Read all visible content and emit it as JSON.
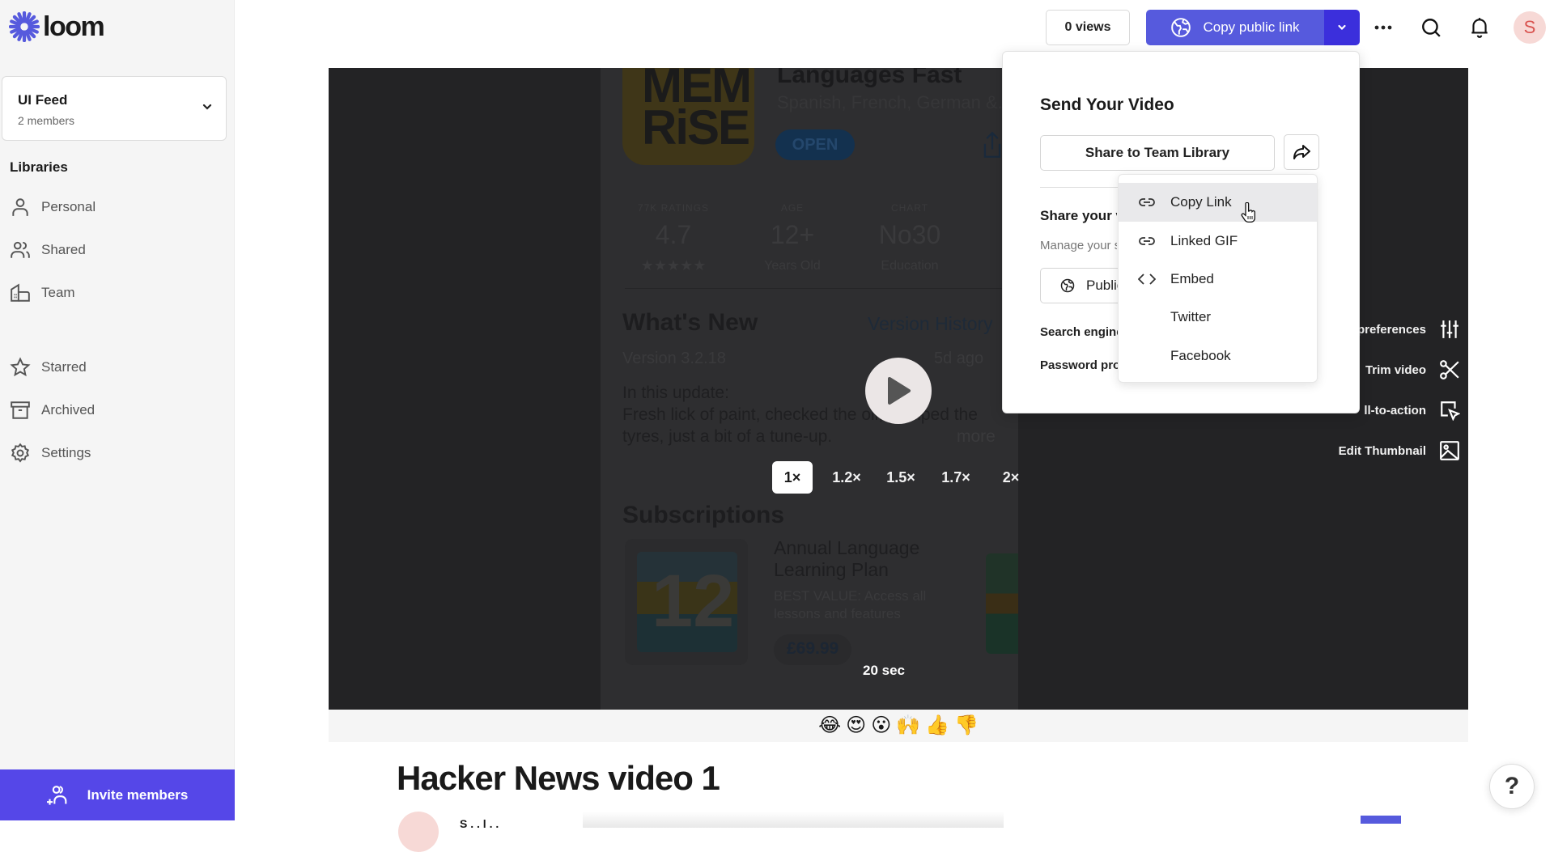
{
  "app": {
    "brand": "loom",
    "brand_color": "#565ADD"
  },
  "sidebar": {
    "workspace": {
      "name": "UI Feed",
      "members": "2 members"
    },
    "libraries_title": "Libraries",
    "items": [
      {
        "label": "Personal",
        "icon": "person-icon"
      },
      {
        "label": "Shared",
        "icon": "people-icon"
      },
      {
        "label": "Team",
        "icon": "building-icon"
      },
      {
        "label": "Starred",
        "icon": "star-icon"
      },
      {
        "label": "Archived",
        "icon": "archive-icon"
      },
      {
        "label": "Settings",
        "icon": "gear-icon"
      }
    ],
    "invite_label": "Invite members"
  },
  "topbar": {
    "views": "0 views",
    "copy_link_label": "Copy public link",
    "avatar_initial": "S"
  },
  "video": {
    "screen": {
      "app_icon_text": "MEM\nRiSE",
      "app_title": "Languages Fast",
      "app_subtitle": "Spanish, French, German &...",
      "open_label": "OPEN",
      "stats": [
        {
          "label": "77K RATINGS",
          "value": "4.7",
          "sub": "★★★★★"
        },
        {
          "label": "AGE",
          "value": "12+",
          "sub": "Years Old"
        },
        {
          "label": "CHART",
          "value": "No30",
          "sub": "Education"
        }
      ],
      "whats_new": "What's New",
      "version_history": "Version History",
      "version": "Version 3.2.18",
      "version_age": "5d ago",
      "update_line1": "In this update:",
      "update_line2": "Fresh lick of paint, checked the oil, pumped the",
      "update_line3": "tyres, just a bit of a tune-up.",
      "more": "more",
      "subscriptions": "Subscriptions",
      "plan_title1": "Annual Language",
      "plan_title2": "Learning Plan",
      "plan_desc1": "BEST VALUE: Access all",
      "plan_desc2": "lessons and features",
      "plan_price": "£69.99",
      "plan_icon_text": "12"
    },
    "speeds": [
      "1×",
      "1.2×",
      "1.5×",
      "1.7×",
      "2×"
    ],
    "active_speed": "1×",
    "duration": "20 sec",
    "tools": [
      {
        "label": "preferences",
        "icon": "sliders-icon"
      },
      {
        "label": "Trim video",
        "icon": "scissors-icon"
      },
      {
        "label": "ll-to-action",
        "icon": "cursor-box-icon"
      },
      {
        "label": "Edit Thumbnail",
        "icon": "image-icon"
      }
    ],
    "reactions": [
      "😂",
      "😍",
      "😮",
      "🙌",
      "👍",
      "👎"
    ],
    "title": "Hacker News video 1",
    "author_partial": "S . . l . ."
  },
  "popover": {
    "title": "Send Your Video",
    "share_team_label": "Share to Team Library",
    "share_your_partial": "Share your v",
    "manage_partial": "Manage your s",
    "public_label": "Public",
    "search_engine_partial": "Search engine",
    "password_partial": "Password pro",
    "menu": [
      {
        "label": "Copy Link",
        "icon": "link-icon",
        "hovered": true
      },
      {
        "label": "Linked GIF",
        "icon": "link-icon",
        "hovered": false
      },
      {
        "label": "Embed",
        "icon": "code-icon",
        "hovered": false
      },
      {
        "label": "Twitter",
        "icon": "",
        "hovered": false
      },
      {
        "label": "Facebook",
        "icon": "",
        "hovered": false
      }
    ]
  },
  "help_label": "?"
}
